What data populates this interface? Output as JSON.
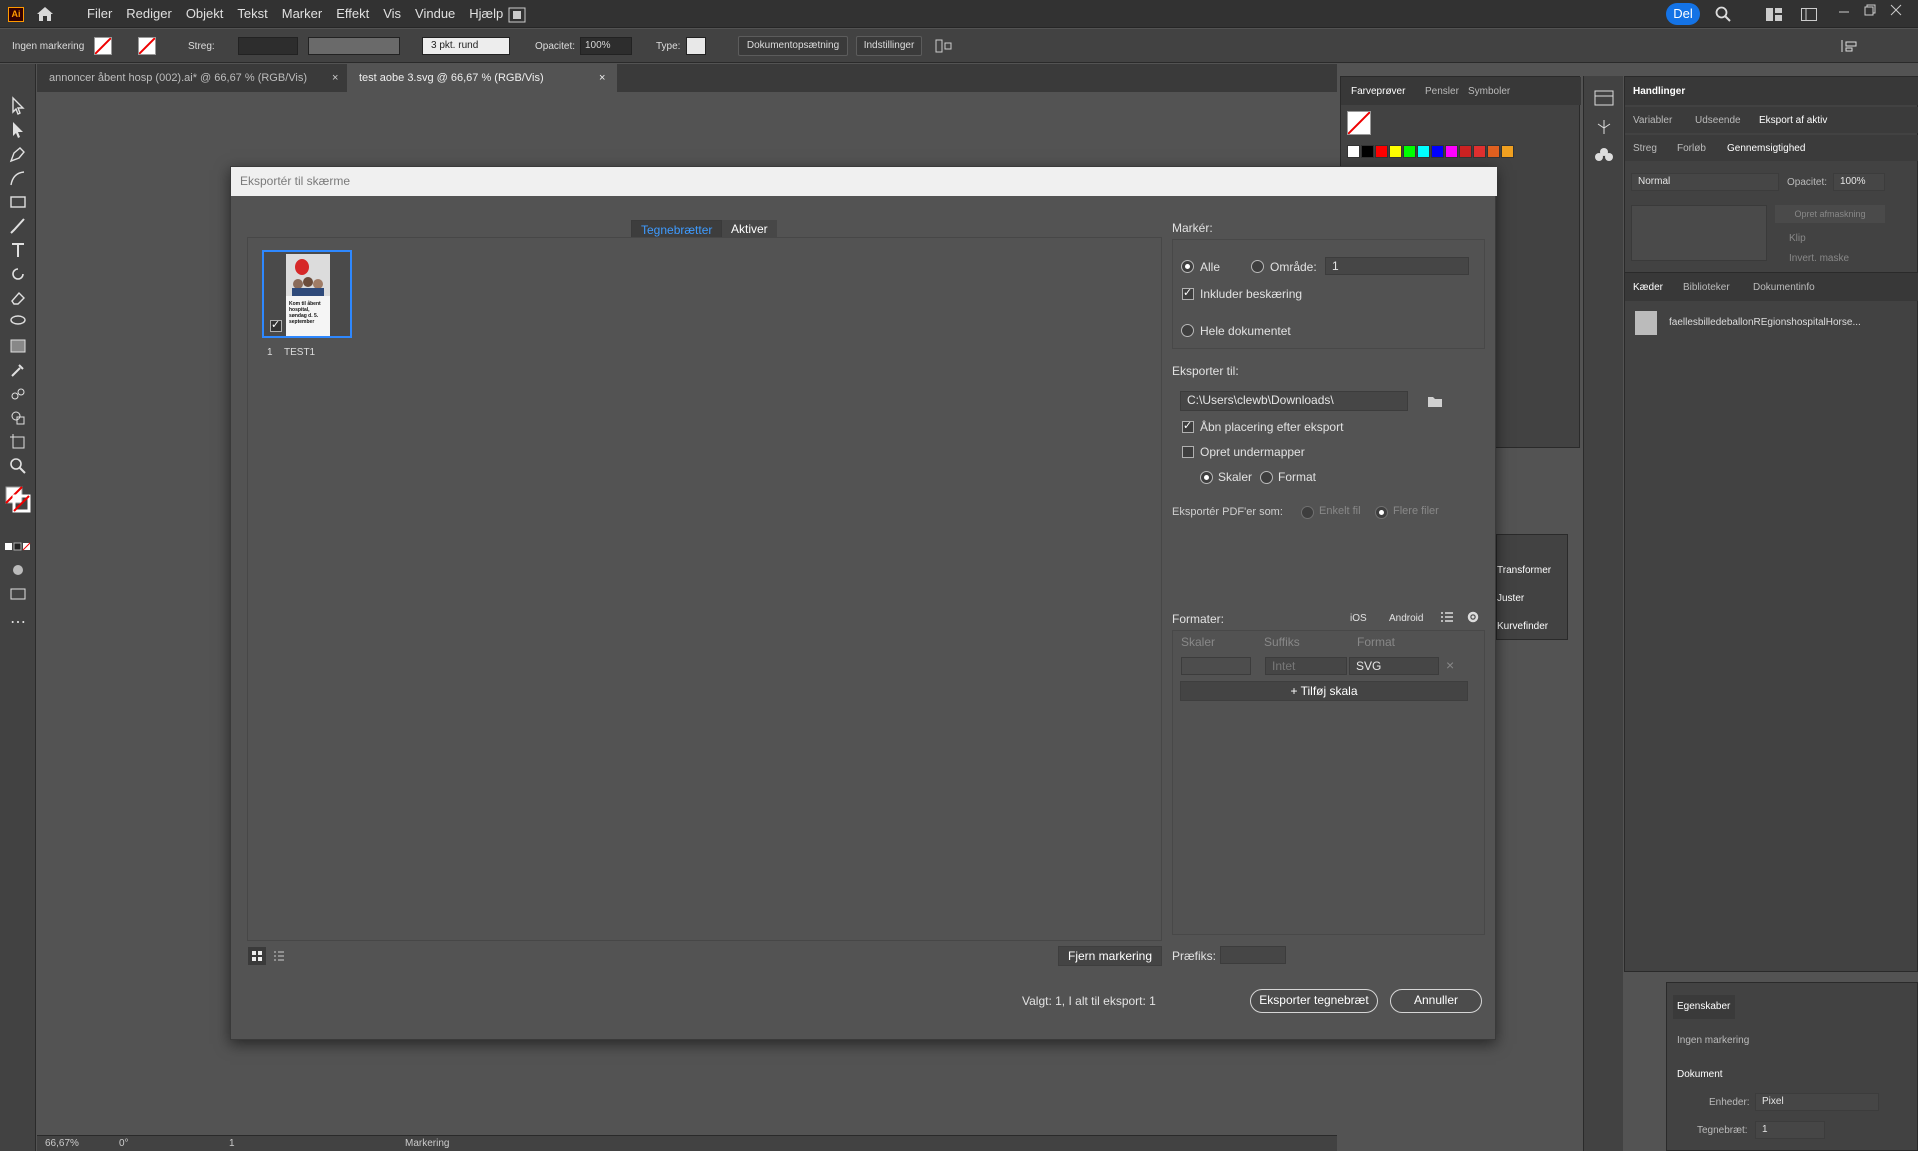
{
  "menubar": {
    "logo": "Ai",
    "items": [
      "Filer",
      "Rediger",
      "Objekt",
      "Tekst",
      "Marker",
      "Effekt",
      "Vis",
      "Vindue",
      "Hjælp"
    ],
    "share_label": "Del"
  },
  "controlbar": {
    "selection": "Ingen markering",
    "stroke_label": "Streg:",
    "brush": "3 pkt. rund",
    "opacity_label": "Opacitet:",
    "opacity_value": "100%",
    "type_label": "Type:",
    "doc_setup": "Dokumentopsætning",
    "settings": "Indstillinger"
  },
  "doc_tabs": [
    {
      "label": "annoncer åbent hosp (002).ai* @ 66,67 % (RGB/Vis)",
      "active": false
    },
    {
      "label": "test aobe 3.svg @ 66,67 % (RGB/Vis)",
      "active": true
    }
  ],
  "swatches_panel": {
    "tabs": [
      "Farveprøver",
      "Pensler",
      "Symboler"
    ]
  },
  "actions_panel": {
    "title": "Handlinger",
    "tabs": [
      "Variabler",
      "Udseende",
      "Eksport af aktiv"
    ],
    "subtabs": [
      "Streg",
      "Forløb",
      "Gennemsigtighed"
    ],
    "blend_mode": "Normal",
    "opacity_label": "Opacitet:",
    "opacity_value": "100%",
    "make_mask": "Opret afmaskning",
    "clip": "Klip",
    "invert_mask": "Invert. maske"
  },
  "links_panel": {
    "tabs": [
      "Kæder",
      "Biblioteker",
      "Dokumentinfo"
    ],
    "item": "faellesbilledeballonREgionshospitalHorse..."
  },
  "float_panel": {
    "items": [
      "Transformer",
      "Juster",
      "Kurvefinder"
    ]
  },
  "properties_panel": {
    "tab": "Egenskaber",
    "selection": "Ingen markering",
    "section": "Dokument",
    "units_label": "Enheder:",
    "units_value": "Pixel",
    "artboard_label": "Tegnebræt:",
    "artboard_value": "1"
  },
  "dialog": {
    "title": "Eksportér til skærme",
    "seg_artboards": "Tegnebrætter",
    "seg_assets": "Aktiver",
    "artboard": {
      "number": "1",
      "name": "TEST1",
      "thumb_text": "Kom til åbent hospital, søndag d. 5. september"
    },
    "select_heading": "Markér:",
    "all_label": "Alle",
    "range_label": "Område:",
    "range_value": "1",
    "include_bleed": "Inkluder beskæring",
    "full_document": "Hele dokumentet",
    "export_to_label": "Eksporter til:",
    "export_path": "C:\\Users\\clewb\\Downloads\\",
    "open_location": "Åbn placering efter eksport",
    "create_subfolders": "Opret undermapper",
    "scale_label": "Skaler",
    "format_label": "Format",
    "export_pdf_label": "Eksportér PDF'er som:",
    "single_file": "Enkelt fil",
    "multiple_files": "Flere filer",
    "formats_heading": "Formater:",
    "ios": "iOS",
    "android": "Android",
    "col_scale": "Skaler",
    "col_suffix": "Suffiks",
    "col_format": "Format",
    "suffix_placeholder": "Intet",
    "format_value": "SVG",
    "add_scale": "Tilføj skala",
    "clear_selection": "Fjern markering",
    "prefix_label": "Præfiks:",
    "status": "Valgt: 1, I alt til eksport: 1",
    "export_button": "Eksporter tegnebræt",
    "cancel_button": "Annuller"
  },
  "statusbar": {
    "zoom": "66,67%",
    "rotation": "0°",
    "artboard": "1",
    "tool": "Markering"
  },
  "colors": {
    "accent": "#1473e6",
    "selection_blue": "#2e88ff"
  }
}
